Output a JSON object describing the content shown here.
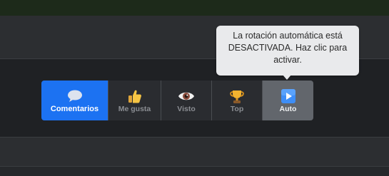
{
  "tooltip": {
    "text": "La rotación automática está DESACTIVADA. Haz clic para activar."
  },
  "toolbar": {
    "buttons": [
      {
        "label": "Comentarios",
        "icon": "speech-bubble-icon",
        "active": true
      },
      {
        "label": "Me gusta",
        "icon": "thumbs-up-icon",
        "active": false
      },
      {
        "label": "Visto",
        "icon": "eye-icon",
        "active": false
      },
      {
        "label": "Top",
        "icon": "trophy-icon",
        "active": false
      },
      {
        "label": "Auto",
        "icon": "play-button-icon",
        "active": false
      }
    ]
  },
  "colors": {
    "accent": "#1c72f2",
    "auto_button": "#62666c",
    "tooltip_bg": "#e9eaec"
  }
}
